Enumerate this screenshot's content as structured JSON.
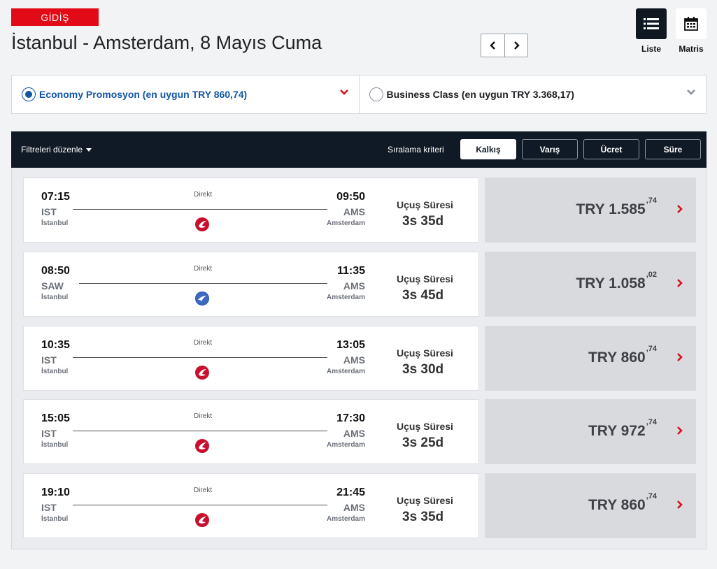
{
  "header": {
    "badge": "GİDİŞ",
    "title": "İstanbul - Amsterdam, 8 Mayıs Cuma"
  },
  "view_toggle": {
    "list_label": "Liste",
    "matrix_label": "Matris",
    "active": "list"
  },
  "cabin_classes": [
    {
      "label": "Economy Promosyon (en uygun TRY 860,74)",
      "selected": true
    },
    {
      "label": "Business Class (en uygun TRY 3.368,17)",
      "selected": false
    }
  ],
  "sort_bar": {
    "filter_label": "Filtreleri düzenle",
    "sort_label": "Sıralama kriteri",
    "options": [
      "Kalkış",
      "Varış",
      "Ücret",
      "Süre"
    ],
    "active": "Kalkış"
  },
  "flights": [
    {
      "dep_time": "07:15",
      "dep_code": "IST",
      "dep_city": "İstanbul",
      "arr_time": "09:50",
      "arr_code": "AMS",
      "arr_city": "Amsterdam",
      "stops": "Direkt",
      "airline": "turkish-airlines",
      "duration_label": "Uçuş Süresi",
      "duration": "3s 35d",
      "price_main": "TRY 1.585",
      "price_decimals": ",74"
    },
    {
      "dep_time": "08:50",
      "dep_code": "SAW",
      "dep_city": "İstanbul",
      "arr_time": "11:35",
      "arr_code": "AMS",
      "arr_city": "Amsterdam",
      "stops": "Direkt",
      "airline": "anadolujet",
      "duration_label": "Uçuş Süresi",
      "duration": "3s 45d",
      "price_main": "TRY 1.058",
      "price_decimals": ",02"
    },
    {
      "dep_time": "10:35",
      "dep_code": "IST",
      "dep_city": "İstanbul",
      "arr_time": "13:05",
      "arr_code": "AMS",
      "arr_city": "Amsterdam",
      "stops": "Direkt",
      "airline": "turkish-airlines",
      "duration_label": "Uçuş Süresi",
      "duration": "3s 30d",
      "price_main": "TRY 860",
      "price_decimals": ",74"
    },
    {
      "dep_time": "15:05",
      "dep_code": "IST",
      "dep_city": "İstanbul",
      "arr_time": "17:30",
      "arr_code": "AMS",
      "arr_city": "Amsterdam",
      "stops": "Direkt",
      "airline": "turkish-airlines",
      "duration_label": "Uçuş Süresi",
      "duration": "3s 25d",
      "price_main": "TRY 972",
      "price_decimals": ",74"
    },
    {
      "dep_time": "19:10",
      "dep_code": "IST",
      "dep_city": "İstanbul",
      "arr_time": "21:45",
      "arr_code": "AMS",
      "arr_city": "Amsterdam",
      "stops": "Direkt",
      "airline": "turkish-airlines",
      "duration_label": "Uçuş Süresi",
      "duration": "3s 35d",
      "price_main": "TRY 860",
      "price_decimals": ",74"
    }
  ],
  "colors": {
    "brand_red": "#e30a17",
    "link_blue": "#1256a6",
    "dark_navy": "#101a26",
    "anadolujet_blue": "#1d4fb3"
  }
}
